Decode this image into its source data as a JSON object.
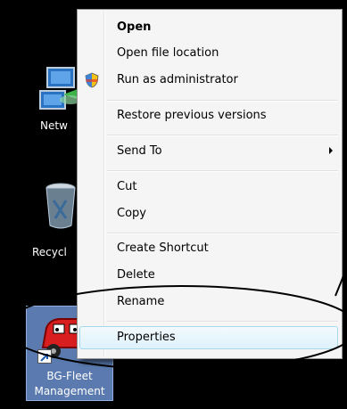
{
  "desktop": {
    "icons": [
      {
        "label": "Netw"
      },
      {
        "label": "Recycl"
      },
      {
        "label_line1": "BG-Fleet",
        "label_line2": "Management"
      }
    ]
  },
  "context_menu": {
    "items": [
      {
        "label": "Open"
      },
      {
        "label": "Open file location"
      },
      {
        "label": "Run as administrator"
      },
      {
        "label": "Restore previous versions"
      },
      {
        "label": "Send To"
      },
      {
        "label": "Cut"
      },
      {
        "label": "Copy"
      },
      {
        "label": "Create Shortcut"
      },
      {
        "label": "Delete"
      },
      {
        "label": "Rename"
      },
      {
        "label": "Properties"
      }
    ]
  }
}
